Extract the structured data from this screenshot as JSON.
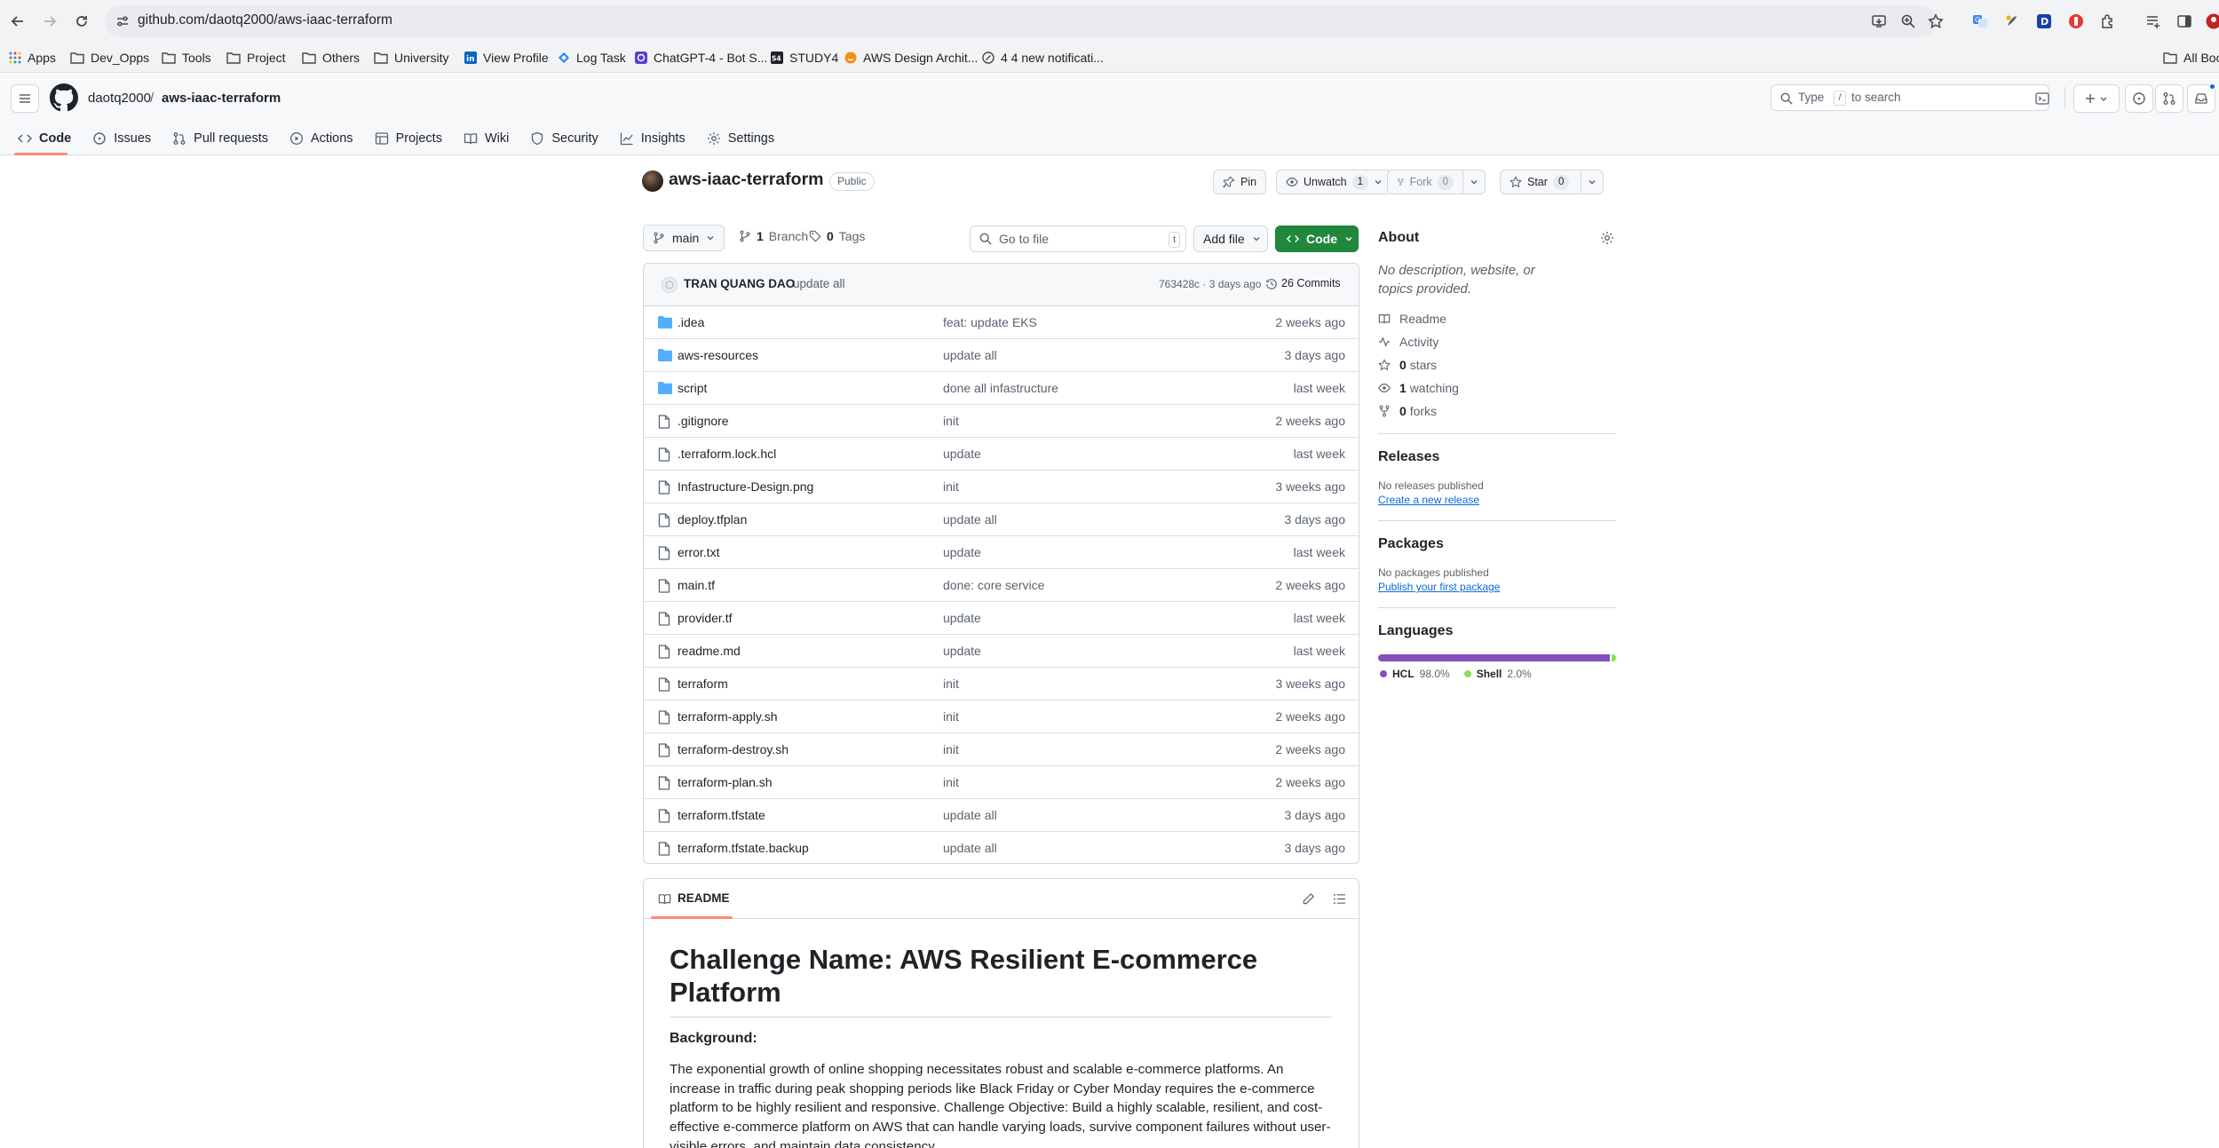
{
  "browser": {
    "url": "github.com/daotq2000/aws-iaac-terraform",
    "bookmarks": [
      {
        "label": "Apps",
        "icon": "apps-grid-icon"
      },
      {
        "label": "Dev_Opps",
        "icon": "folder-icon"
      },
      {
        "label": "Tools",
        "icon": "folder-icon"
      },
      {
        "label": "Project",
        "icon": "folder-icon"
      },
      {
        "label": "Others",
        "icon": "folder-icon"
      },
      {
        "label": "University",
        "icon": "folder-icon"
      },
      {
        "label": "View Profile",
        "icon": "linkedin-icon"
      },
      {
        "label": "Log Task",
        "icon": "jira-icon"
      },
      {
        "label": "ChatGPT-4 - Bot S...",
        "icon": "bot-icon"
      },
      {
        "label": "STUDY4",
        "icon": "study4-icon"
      },
      {
        "label": "AWS Design Archit...",
        "icon": "aws-icon"
      },
      {
        "label": "4 4 new notificati...",
        "icon": "notification-icon"
      }
    ],
    "all_bookmarks": "All Boo"
  },
  "github": {
    "owner": "daotq2000",
    "separator": "/",
    "repo": "aws-iaac-terraform",
    "search_prefix": "Type",
    "search_key": "/",
    "search_suffix": "to search",
    "tabs": [
      {
        "label": "Code",
        "icon": "code-icon"
      },
      {
        "label": "Issues",
        "icon": "issue-icon"
      },
      {
        "label": "Pull requests",
        "icon": "pull-request-icon"
      },
      {
        "label": "Actions",
        "icon": "play-icon"
      },
      {
        "label": "Projects",
        "icon": "table-icon"
      },
      {
        "label": "Wiki",
        "icon": "book-icon"
      },
      {
        "label": "Security",
        "icon": "shield-icon"
      },
      {
        "label": "Insights",
        "icon": "graph-icon"
      },
      {
        "label": "Settings",
        "icon": "gear-icon"
      }
    ]
  },
  "repo": {
    "name": "aws-iaac-terraform",
    "visibility": "Public",
    "pin": "Pin",
    "unwatch": "Unwatch",
    "watch_count": "1",
    "fork": "Fork",
    "fork_count": "0",
    "star": "Star",
    "star_count": "0"
  },
  "toolbar": {
    "branch": "main",
    "branch_count": "1",
    "branch_label": "Branch",
    "tag_count": "0",
    "tag_label": "Tags",
    "goto_placeholder": "Go to file",
    "goto_key": "t",
    "add_file": "Add file",
    "code": "Code"
  },
  "commit": {
    "author": "TRAN QUANG DAO",
    "message": "update all",
    "hash_time": "763428c · 3 days ago",
    "commits": "26 Commits"
  },
  "files": [
    {
      "name": ".idea",
      "type": "folder",
      "message": "feat: update EKS",
      "date": "2 weeks ago"
    },
    {
      "name": "aws-resources",
      "type": "folder",
      "message": "update all",
      "date": "3 days ago"
    },
    {
      "name": "script",
      "type": "folder",
      "message": "done all infastructure",
      "date": "last week"
    },
    {
      "name": ".gitignore",
      "type": "file",
      "message": "init",
      "date": "2 weeks ago"
    },
    {
      "name": ".terraform.lock.hcl",
      "type": "file",
      "message": "update",
      "date": "last week"
    },
    {
      "name": "Infastructure-Design.png",
      "type": "file",
      "message": "init",
      "date": "3 weeks ago"
    },
    {
      "name": "deploy.tfplan",
      "type": "file",
      "message": "update all",
      "date": "3 days ago"
    },
    {
      "name": "error.txt",
      "type": "file",
      "message": "update",
      "date": "last week"
    },
    {
      "name": "main.tf",
      "type": "file",
      "message": "done: core service",
      "date": "2 weeks ago"
    },
    {
      "name": "provider.tf",
      "type": "file",
      "message": "update",
      "date": "last week"
    },
    {
      "name": "readme.md",
      "type": "file",
      "message": "update",
      "date": "last week"
    },
    {
      "name": "terraform",
      "type": "file",
      "message": "init",
      "date": "3 weeks ago"
    },
    {
      "name": "terraform-apply.sh",
      "type": "file",
      "message": "init",
      "date": "2 weeks ago"
    },
    {
      "name": "terraform-destroy.sh",
      "type": "file",
      "message": "init",
      "date": "2 weeks ago"
    },
    {
      "name": "terraform-plan.sh",
      "type": "file",
      "message": "init",
      "date": "2 weeks ago"
    },
    {
      "name": "terraform.tfstate",
      "type": "file",
      "message": "update all",
      "date": "3 days ago"
    },
    {
      "name": "terraform.tfstate.backup",
      "type": "file",
      "message": "update all",
      "date": "3 days ago"
    }
  ],
  "readme": {
    "tab": "README",
    "title": "Challenge Name: AWS Resilient E-commerce Platform",
    "background_heading": "Background:",
    "paragraph": "The exponential growth of online shopping necessitates robust and scalable e-commerce platforms. An increase in traffic during peak shopping periods like Black Friday or Cyber Monday requires the e-commerce platform to be highly resilient and responsive. Challenge Objective: Build a highly scalable, resilient, and cost-effective e-commerce platform on AWS that can handle varying loads, survive component failures without user-visible errors, and maintain data consistency."
  },
  "about": {
    "heading": "About",
    "description": "No description, website, or topics provided.",
    "readme": "Readme",
    "activity": "Activity",
    "stars_count": "0",
    "stars_label": "stars",
    "watching_count": "1",
    "watching_label": "watching",
    "forks_count": "0",
    "forks_label": "forks"
  },
  "releases": {
    "heading": "Releases",
    "none": "No releases published",
    "create": "Create a new release"
  },
  "packages": {
    "heading": "Packages",
    "none": "No packages published",
    "publish": "Publish your first package"
  },
  "languages": {
    "heading": "Languages",
    "items": [
      {
        "name": "HCL",
        "percent": "98.0%",
        "value": 98.0,
        "color": "#844fba"
      },
      {
        "name": "Shell",
        "percent": "2.0%",
        "value": 2.0,
        "color": "#89e051"
      }
    ]
  }
}
